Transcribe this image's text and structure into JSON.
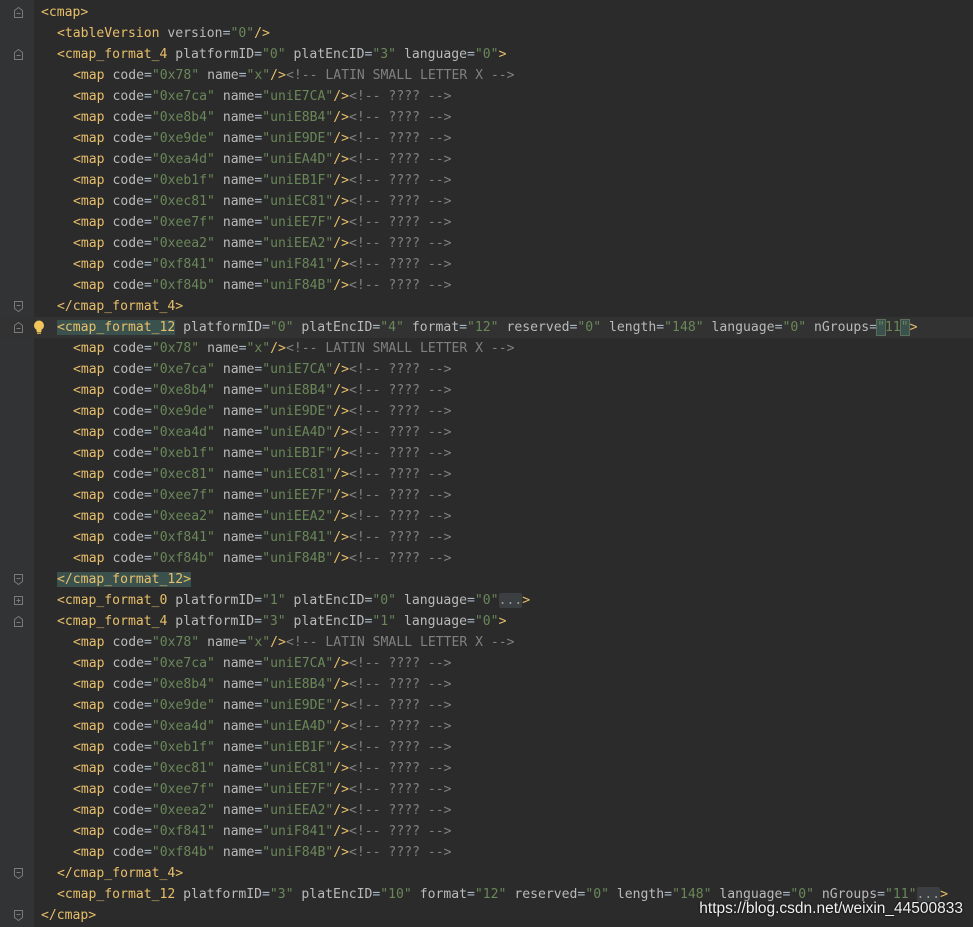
{
  "colors": {
    "background": "#2b2b2b",
    "gutter": "#313335",
    "tag": "#e8bf6a",
    "attribute": "#bababa",
    "value": "#6a8759",
    "comment": "#808080",
    "tag_match_highlight": "#3b514d"
  },
  "icons": {
    "fold_open": "fold-minus-icon",
    "fold_closed": "fold-plus-icon",
    "fold_end": "fold-end-icon",
    "intention": "lightbulb-icon"
  },
  "editor": {
    "root_open": "<cmap>",
    "root_close": "</cmap>",
    "table_version": {
      "tag": "<tableVersion",
      "attr": "version",
      "value": "\"0\"",
      "close": "/>"
    },
    "map_tag": "<map",
    "map_self_close": "/>",
    "tag_end": ">",
    "eq": "=",
    "space": " ",
    "comment_latin_x": "<!-- LATIN SMALL LETTER X -->",
    "comment_unknown": "<!-- ???? -->",
    "attr_code": "code",
    "attr_name": "name",
    "maps": [
      {
        "code": "\"0x78\"",
        "name": "\"x\"",
        "comment_key": "latin"
      },
      {
        "code": "\"0xe7ca\"",
        "name": "\"uniE7CA\""
      },
      {
        "code": "\"0xe8b4\"",
        "name": "\"uniE8B4\""
      },
      {
        "code": "\"0xe9de\"",
        "name": "\"uniE9DE\""
      },
      {
        "code": "\"0xea4d\"",
        "name": "\"uniEA4D\""
      },
      {
        "code": "\"0xeb1f\"",
        "name": "\"uniEB1F\""
      },
      {
        "code": "\"0xec81\"",
        "name": "\"uniEC81\""
      },
      {
        "code": "\"0xee7f\"",
        "name": "\"uniEE7F\""
      },
      {
        "code": "\"0xeea2\"",
        "name": "\"uniEEA2\""
      },
      {
        "code": "\"0xf841\"",
        "name": "\"uniF841\""
      },
      {
        "code": "\"0xf84b\"",
        "name": "\"uniF84B\""
      }
    ],
    "subtables": [
      {
        "tag": "<cmap_format_4",
        "attrs": [
          {
            "k": "platformID",
            "v": "\"0\""
          },
          {
            "k": "platEncID",
            "v": "\"3\""
          },
          {
            "k": "language",
            "v": "\"0\""
          }
        ],
        "close": "</cmap_format_4>",
        "expanded": true
      },
      {
        "tag": "<cmap_format_12",
        "attrs": [
          {
            "k": "platformID",
            "v": "\"0\""
          },
          {
            "k": "platEncID",
            "v": "\"4\""
          },
          {
            "k": "format",
            "v": "\"12\""
          },
          {
            "k": "reserved",
            "v": "\"0\""
          },
          {
            "k": "length",
            "v": "\"148\""
          },
          {
            "k": "language",
            "v": "\"0\""
          },
          {
            "k": "nGroups",
            "v": "\"11\""
          }
        ],
        "close": "</cmap_format_12>",
        "expanded": true,
        "current": true
      },
      {
        "tag": "<cmap_format_0",
        "attrs": [
          {
            "k": "platformID",
            "v": "\"1\""
          },
          {
            "k": "platEncID",
            "v": "\"0\""
          },
          {
            "k": "language",
            "v": "\"0\""
          }
        ],
        "collapsed_marker": "...",
        "expanded": false
      },
      {
        "tag": "<cmap_format_4",
        "attrs": [
          {
            "k": "platformID",
            "v": "\"3\""
          },
          {
            "k": "platEncID",
            "v": "\"1\""
          },
          {
            "k": "language",
            "v": "\"0\""
          }
        ],
        "close": "</cmap_format_4>",
        "expanded": true
      },
      {
        "tag": "<cmap_format_12",
        "attrs": [
          {
            "k": "platformID",
            "v": "\"3\""
          },
          {
            "k": "platEncID",
            "v": "\"10\""
          },
          {
            "k": "format",
            "v": "\"12\""
          },
          {
            "k": "reserved",
            "v": "\"0\""
          },
          {
            "k": "length",
            "v": "\"148\""
          },
          {
            "k": "language",
            "v": "\"0\""
          },
          {
            "k": "nGroups",
            "v": "\"11\""
          }
        ],
        "collapsed_marker": "...",
        "expanded": false
      }
    ]
  },
  "watermark": "https://blog.csdn.net/weixin_44500833"
}
